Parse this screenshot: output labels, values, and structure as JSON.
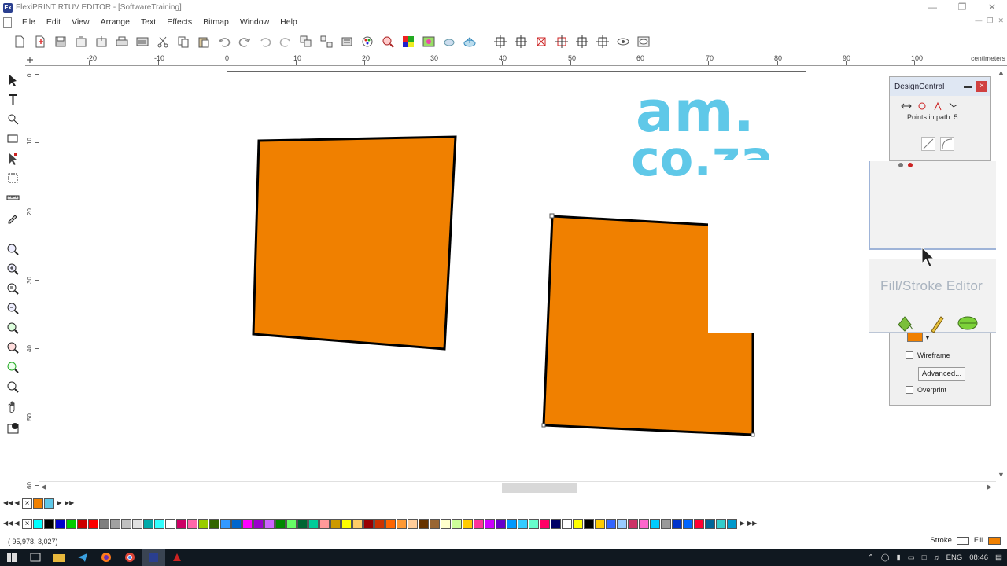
{
  "window": {
    "title": "FlexiPRINT RTUV EDITOR - [SoftwareTraining]",
    "app_icon": "Fx",
    "buttons": [
      "—",
      "❐",
      "✕"
    ],
    "mdi_buttons": [
      "—",
      "❐",
      "✕"
    ]
  },
  "menu": {
    "items": [
      "File",
      "Edit",
      "View",
      "Arrange",
      "Text",
      "Effects",
      "Bitmap",
      "Window",
      "Help"
    ]
  },
  "toolbar": {
    "icons": [
      "new-icon",
      "open-icon",
      "save-icon",
      "import-icon",
      "export-icon",
      "print-icon",
      "production-manager-icon",
      "cut-icon",
      "copy-icon",
      "paste-icon",
      "undo-icon",
      "redo-icon",
      "undo-list-icon",
      "redo-list-icon",
      "group-icon",
      "ungroup-icon",
      "lock-icon",
      "color-icon",
      "zoom-icon",
      "swatch-icon",
      "effect-icon",
      "cloud-icon",
      "upload-icon",
      "align-left-icon",
      "align-center-icon",
      "align-right-icon",
      "align-top-icon",
      "align-middle-icon",
      "align-bottom-icon",
      "preview-icon",
      "view-options-icon"
    ]
  },
  "ruler": {
    "unit": "centimeters",
    "top_labels": [
      "-20",
      "-10",
      "0",
      "10",
      "20",
      "30",
      "40",
      "50",
      "60",
      "70",
      "80",
      "90",
      "100"
    ],
    "left_labels": [
      "0",
      "10",
      "20",
      "30",
      "40",
      "50",
      "60"
    ]
  },
  "canvas": {
    "logo_line1": "am.",
    "logo_line2": "co.za",
    "logo_color": "#5fc8e8",
    "shape_fill": "#f08000",
    "shape_stroke": "#000000"
  },
  "design_central": {
    "title": "DesignCentral",
    "points_in_path": "Points in path:  5"
  },
  "fill_stroke": {
    "title": "Fill/Stroke Editor",
    "fill_color": "#f08000",
    "wireframe": "Wireframe",
    "advanced": "Advanced...",
    "overprint": "Overprint"
  },
  "palette": {
    "recent": [
      "#f08000",
      "#5fc8e8"
    ],
    "colors": [
      "#00ffff",
      "#000000",
      "#0000cc",
      "#00cc00",
      "#cc0000",
      "#ff0000",
      "#808080",
      "#a0a0a0",
      "#c0c0c0",
      "#e0e0e0",
      "#00aaaa",
      "#33ffff",
      "#ffffff",
      "#cc0066",
      "#ff66aa",
      "#99cc00",
      "#336600",
      "#3399ff",
      "#0066cc",
      "#ff00ff",
      "#9900cc",
      "#cc66ff",
      "#008800",
      "#66ff66",
      "#006633",
      "#00cc99",
      "#ff9999",
      "#cc9900",
      "#ffff00",
      "#ffcc66",
      "#990000",
      "#cc3300",
      "#ff6600",
      "#ff9933",
      "#ffcc99",
      "#663300",
      "#996633",
      "#ffffcc",
      "#ccff99",
      "#ffcc00",
      "#ff3399",
      "#cc00ff",
      "#6600cc",
      "#0099ff",
      "#33ccff",
      "#66ffcc",
      "#ff0066",
      "#000066",
      "#ffffff",
      "#ffff00",
      "#000000",
      "#ffcc00",
      "#3366ff",
      "#99ccff",
      "#cc3366",
      "#ff66cc",
      "#00ccff",
      "#999999",
      "#0033cc",
      "#0066ff",
      "#ff0033",
      "#006699",
      "#33cccc",
      "#0099cc"
    ]
  },
  "status": {
    "coords": "( 95,978,   3,027)",
    "stroke_label": "Stroke",
    "fill_label": "Fill"
  },
  "taskbar": {
    "tray_lang": "ENG",
    "time": "08:46"
  }
}
